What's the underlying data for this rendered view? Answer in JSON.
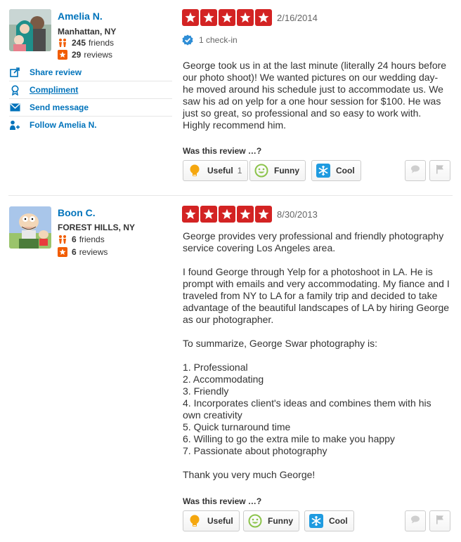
{
  "colors": {
    "link": "#0073bb",
    "star_bg": "#d32323",
    "friends_icon": "#f15c00",
    "reviews_icon": "#f15c00"
  },
  "reviews": [
    {
      "user": {
        "name": "Amelia N.",
        "location": "Manhattan, NY",
        "friends_count": "245",
        "friends_label": "friends",
        "reviews_count": "29",
        "reviews_label": "reviews"
      },
      "actions": [
        {
          "icon": "share-icon",
          "label": "Share review"
        },
        {
          "icon": "compliment-icon",
          "label": "Compliment"
        },
        {
          "icon": "message-icon",
          "label": "Send message"
        },
        {
          "icon": "follow-icon",
          "label": "Follow Amelia N."
        }
      ],
      "rating": 5,
      "date": "2/16/2014",
      "checkin": "1 check-in",
      "text": "George took us in at the last minute (literally 24 hours before our photo shoot)! We wanted pictures on our wedding day- he moved around his schedule just to accommodate us. We saw his ad on yelp for a one hour session for $100. He was just so great, so professional and so easy to work with. Highly recommend him.",
      "was_this_review": "Was this review …?",
      "votes": {
        "useful_label": "Useful",
        "useful_count": "1",
        "funny_label": "Funny",
        "cool_label": "Cool"
      }
    },
    {
      "user": {
        "name": "Boon C.",
        "location": "FOREST HILLS, NY",
        "friends_count": "6",
        "friends_label": "friends",
        "reviews_count": "6",
        "reviews_label": "reviews"
      },
      "rating": 5,
      "date": "8/30/2013",
      "text": "George provides very professional and friendly photography service covering Los Angeles area.\n\nI found George through Yelp for a photoshoot in LA. He is prompt with emails and very accommodating. My fiance and I traveled from NY to LA for a family trip and decided to take advantage of the beautiful landscapes of LA by hiring George as our photographer.\n\nTo summarize, George Swar photography is:\n\n1. Professional\n2. Accommodating\n3. Friendly\n4. Incorporates client's ideas and combines them with his own creativity\n5. Quick turnaround time\n6. Willing to go the extra mile to make you happy\n7. Passionate about photography\n\nThank you very much George!",
      "was_this_review": "Was this review …?",
      "votes": {
        "useful_label": "Useful",
        "funny_label": "Funny",
        "cool_label": "Cool"
      }
    }
  ]
}
